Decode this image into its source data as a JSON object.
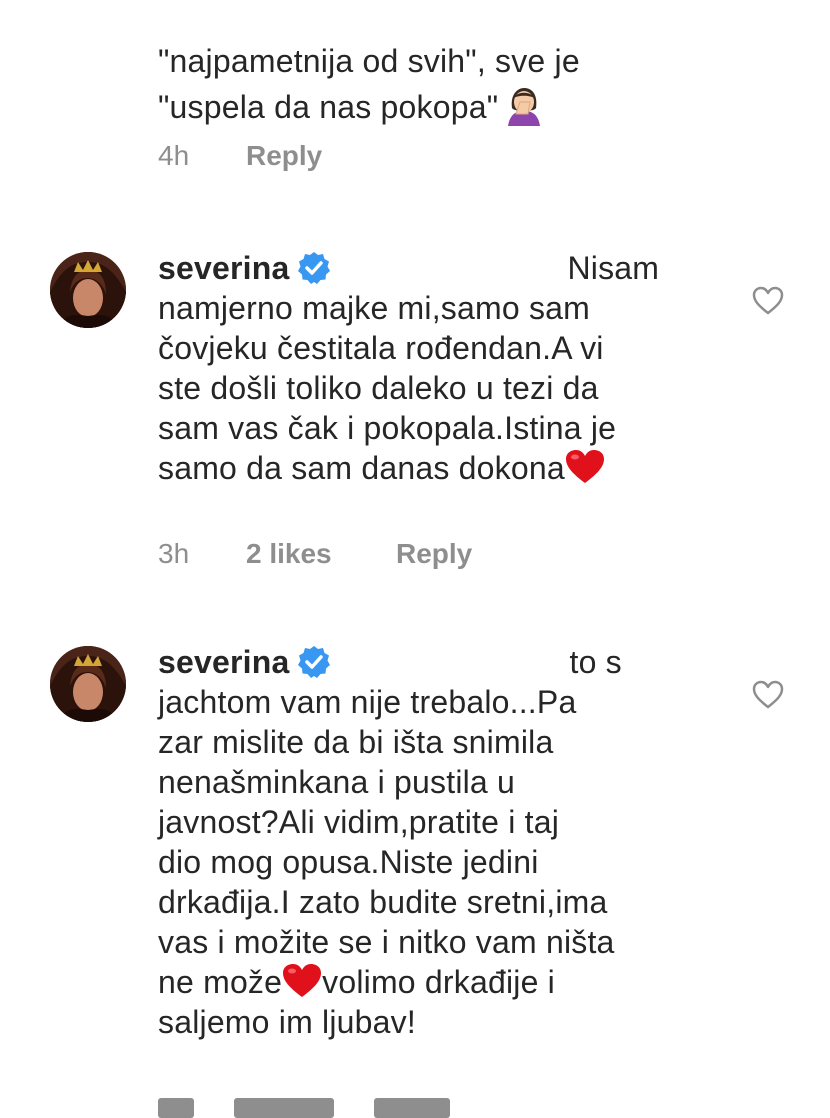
{
  "top_comment": {
    "line1": "\"najpametnija od svih\", sve je",
    "line2": "\"uspela da nas pokopa\"",
    "emoji": "woman-facepalming-emoji",
    "time": "4h",
    "reply": "Reply"
  },
  "comments": [
    {
      "username": "severina",
      "lines": [
        "Nisam",
        "namjerno majke mi,samo sam",
        "čovjeku čestitala rođendan.A vi",
        "ste došli toliko daleko u tezi da",
        "sam vas čak i pokopala.Istina je",
        "samo da sam danas dokona"
      ],
      "time": "3h",
      "likes": "2 likes",
      "reply": "Reply"
    },
    {
      "username": "severina",
      "lines": [
        "to s",
        "jachtom vam nije trebalo...Pa",
        "zar mislite da bi išta snimila",
        "nenašminkana i pustila u",
        "javnost?Ali vidim,pratite i taj",
        "dio mog opusa.Niste jedini",
        "drkađija.I zato budite sretni,ima",
        "vas i možite se i nitko vam ništa",
        "ne može",
        "volimo drkađije i",
        "saljemo im ljubav!"
      ]
    }
  ],
  "colors": {
    "text": "#262626",
    "muted": "#8e8e8e",
    "verified": "#3897f0",
    "heart_red": "#e0111b"
  }
}
